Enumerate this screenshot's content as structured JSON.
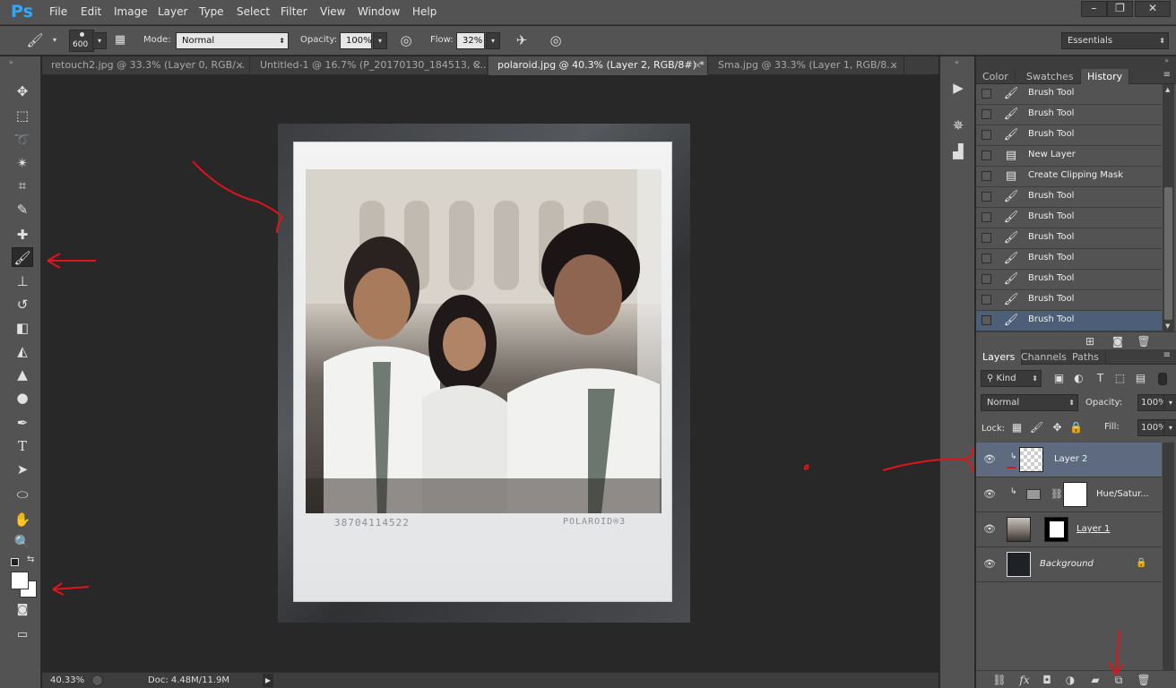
{
  "app": {
    "logo": "Ps"
  },
  "menu": [
    "File",
    "Edit",
    "Image",
    "Layer",
    "Type",
    "Select",
    "Filter",
    "View",
    "Window",
    "Help"
  ],
  "window_controls": [
    "minimize-icon",
    "restore-icon",
    "close-icon"
  ],
  "options": {
    "brush_size": "600",
    "mode_label": "Mode:",
    "mode_value": "Normal",
    "opacity_label": "Opacity:",
    "opacity_value": "100%",
    "flow_label": "Flow:",
    "flow_value": "32%",
    "workspace": "Essentials"
  },
  "tabs": [
    {
      "label": "retouch2.jpg @ 33.3% (Layer 0, RGB/...",
      "active": false
    },
    {
      "label": "Untitled-1 @ 16.7% (P_20170130_184513, C...",
      "active": false
    },
    {
      "label": "polaroid.jpg @ 40.3% (Layer 2, RGB/8#) *",
      "active": true
    },
    {
      "label": "Sma.jpg @ 33.3% (Layer 1, RGB/8...",
      "active": false
    }
  ],
  "canvas": {
    "serial_text": "38704114522",
    "brand_text": "POLAROID®3"
  },
  "status": {
    "zoom": "40.33%",
    "doc": "Doc: 4.48M/11.9M"
  },
  "history_panel": {
    "tabs": [
      "Color",
      "Swatches",
      "History"
    ],
    "active_tab": "History",
    "items": [
      {
        "label": "Brush Tool",
        "icon": "brush-icon",
        "selected": false
      },
      {
        "label": "Brush Tool",
        "icon": "brush-icon",
        "selected": false
      },
      {
        "label": "Brush Tool",
        "icon": "brush-icon",
        "selected": false
      },
      {
        "label": "New Layer",
        "icon": "document-icon",
        "selected": false
      },
      {
        "label": "Create Clipping Mask",
        "icon": "document-icon",
        "selected": false
      },
      {
        "label": "Brush Tool",
        "icon": "brush-icon",
        "selected": false
      },
      {
        "label": "Brush Tool",
        "icon": "brush-icon",
        "selected": false
      },
      {
        "label": "Brush Tool",
        "icon": "brush-icon",
        "selected": false
      },
      {
        "label": "Brush Tool",
        "icon": "brush-icon",
        "selected": false
      },
      {
        "label": "Brush Tool",
        "icon": "brush-icon",
        "selected": false
      },
      {
        "label": "Brush Tool",
        "icon": "brush-icon",
        "selected": false
      },
      {
        "label": "Brush Tool",
        "icon": "brush-icon",
        "selected": true
      }
    ]
  },
  "layers_panel": {
    "tabs": [
      "Layers",
      "Channels",
      "Paths"
    ],
    "active_tab": "Layers",
    "filter_label": "Kind",
    "blend_mode": "Normal",
    "opacity_label": "Opacity:",
    "opacity_value": "100%",
    "lock_label": "Lock:",
    "fill_label": "Fill:",
    "fill_value": "100%",
    "layers": [
      {
        "name": "Layer 2",
        "selected": true
      },
      {
        "name": "Hue/Satur...",
        "selected": false
      },
      {
        "name": "Layer 1",
        "selected": false
      },
      {
        "name": "Background",
        "selected": false
      }
    ]
  },
  "colors": {
    "accent": "#31a8ff",
    "selection": "#4d5e78",
    "annotation": "#e0141a"
  }
}
